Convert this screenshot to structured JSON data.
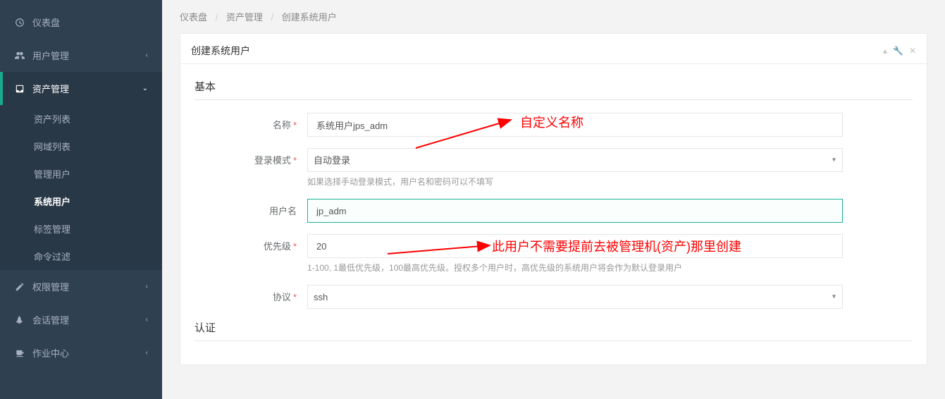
{
  "sidebar": {
    "items": [
      {
        "icon": "dashboard",
        "label": "仪表盘",
        "expandable": false
      },
      {
        "icon": "users",
        "label": "用户管理",
        "expandable": true
      },
      {
        "icon": "inbox",
        "label": "资产管理",
        "expandable": true,
        "active": true,
        "children": [
          {
            "label": "资产列表"
          },
          {
            "label": "网域列表"
          },
          {
            "label": "管理用户"
          },
          {
            "label": "系统用户",
            "active": true
          },
          {
            "label": "标签管理"
          },
          {
            "label": "命令过滤"
          }
        ]
      },
      {
        "icon": "edit",
        "label": "权限管理",
        "expandable": true
      },
      {
        "icon": "rocket",
        "label": "会话管理",
        "expandable": true
      },
      {
        "icon": "coffee",
        "label": "作业中心",
        "expandable": true
      }
    ]
  },
  "breadcrumb": {
    "items": [
      "仪表盘",
      "资产管理",
      "创建系统用户"
    ]
  },
  "panel": {
    "title": "创建系统用户"
  },
  "form": {
    "section_basic": "基本",
    "section_auth": "认证",
    "name": {
      "label": "名称",
      "value": "系统用户jps_adm",
      "required": true
    },
    "login_mode": {
      "label": "登录模式",
      "value": "自动登录",
      "required": true,
      "help": "如果选择手动登录模式，用户名和密码可以不填写"
    },
    "username": {
      "label": "用户名",
      "value": "jp_adm"
    },
    "priority": {
      "label": "优先级",
      "value": "20",
      "required": true,
      "help": "1-100, 1最低优先级，100最高优先级。授权多个用户时，高优先级的系统用户将会作为默认登录用户"
    },
    "protocol": {
      "label": "协议",
      "value": "ssh",
      "required": true
    }
  },
  "annotations": {
    "a1": "自定义名称",
    "a2": "此用户不需要提前去被管理机(资产)那里创建"
  }
}
